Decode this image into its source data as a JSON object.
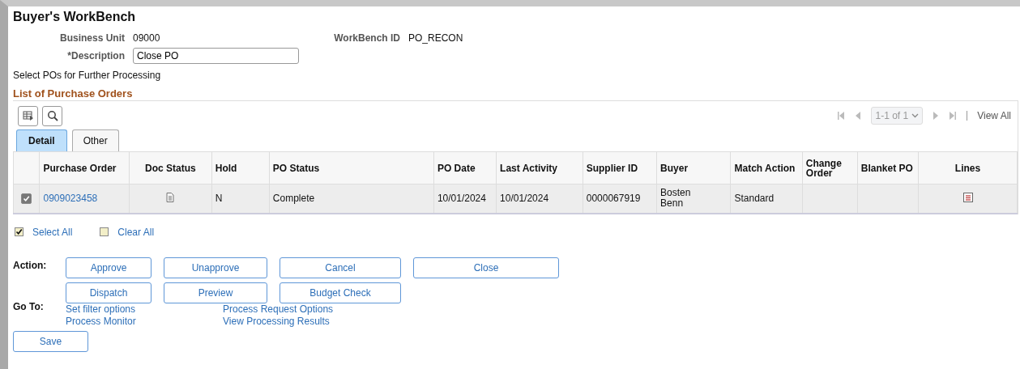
{
  "page_title": "Buyer's WorkBench",
  "header": {
    "business_unit": {
      "label": "Business Unit",
      "value": "09000"
    },
    "workbench_id": {
      "label": "WorkBench ID",
      "value": "PO_RECON"
    },
    "description": {
      "label": "*Description",
      "value": "Close PO"
    }
  },
  "instruction": "Select POs for Further Processing",
  "grid": {
    "title": "List of Purchase Orders",
    "pager": {
      "range": "1-1 of 1",
      "view_all": "View All"
    },
    "tabs": [
      {
        "label": "Detail",
        "selected": true
      },
      {
        "label": "Other",
        "selected": false
      }
    ],
    "columns": [
      "Purchase Order",
      "Doc Status",
      "Hold",
      "PO Status",
      "PO Date",
      "Last Activity",
      "Supplier ID",
      "Buyer",
      "Match Action",
      "Change Order",
      "Blanket PO",
      "Lines"
    ],
    "rows": [
      {
        "checked": true,
        "purchase_order": "0909023458",
        "hold": "N",
        "po_status": "Complete",
        "po_date": "10/01/2024",
        "last_activity": "10/01/2024",
        "supplier_id": "0000067919",
        "buyer": [
          "Bosten",
          "Benn"
        ],
        "match_action": "Standard"
      }
    ]
  },
  "select_links": [
    {
      "label": "Select All",
      "checked": true
    },
    {
      "label": "Clear All",
      "checked": false
    }
  ],
  "action": {
    "label": "Action:",
    "button_rows": [
      [
        "Approve",
        "Unapprove",
        "Cancel",
        "Close"
      ],
      [
        "Dispatch",
        "Preview",
        "Budget Check"
      ]
    ]
  },
  "go_to": {
    "label": "Go To:",
    "link_columns": [
      [
        "Set filter options",
        "Process Monitor"
      ],
      [
        "Process Request Options",
        "View Processing Results"
      ]
    ]
  },
  "save_button": "Save"
}
